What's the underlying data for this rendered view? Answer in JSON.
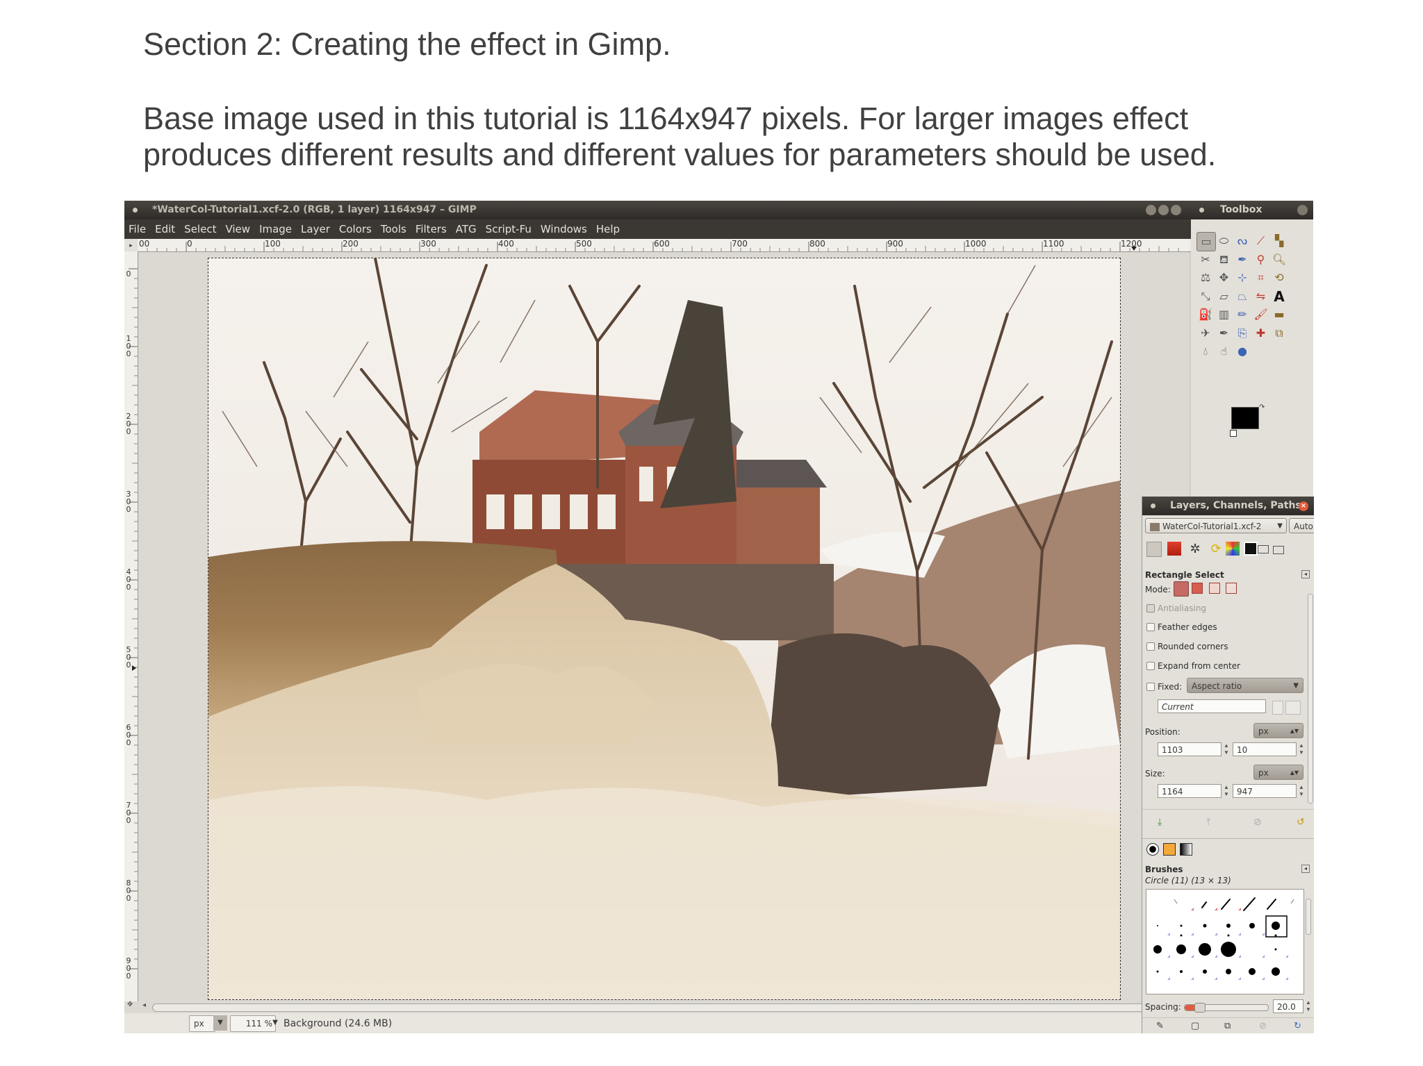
{
  "slide": {
    "title": "Section 2:  Creating the effect in Gimp.",
    "line1": "Base image used in this tutorial is 1164x947 pixels.  For larger images effect",
    "line2": "produces different results and different values for parameters should be used."
  },
  "gimp": {
    "window_title": "*WaterCol-Tutorial1.xcf-2.0 (RGB, 1 layer) 1164x947 – GIMP",
    "menu": [
      "File",
      "Edit",
      "Select",
      "View",
      "Image",
      "Layer",
      "Colors",
      "Tools",
      "Filters",
      "ATG",
      "Script-Fu",
      "Windows",
      "Help"
    ],
    "ruler_top": [
      "0",
      "100",
      "200",
      "300",
      "400",
      "500",
      "600",
      "700",
      "800",
      "900",
      "1000",
      "1100",
      "1200"
    ],
    "ruler_top_start": "00",
    "ruler_left": [
      "0",
      "100",
      "200",
      "300",
      "400",
      "500",
      "600",
      "700",
      "800",
      "900"
    ],
    "status": {
      "unit": "px",
      "zoom": "111 %",
      "info": "Background (24.6 MB)"
    }
  },
  "toolbox": {
    "title": "Toolbox",
    "fg_color": "#000000",
    "bg_color": "#ffffff",
    "tools": [
      "rect-select-icon",
      "ellipse-select-icon",
      "free-select-icon",
      "fuzzy-select-icon",
      "select-by-color-icon",
      "scissors-icon",
      "foreground-select-icon",
      "paths-icon",
      "color-picker-icon",
      "zoom-icon",
      "measure-icon",
      "move-icon",
      "align-icon",
      "crop-icon",
      "rotate-icon",
      "scale-icon",
      "shear-icon",
      "perspective-icon",
      "flip-icon",
      "text-icon",
      "bucket-fill-icon",
      "blend-icon",
      "pencil-icon",
      "paintbrush-icon",
      "eraser-icon",
      "airbrush-icon",
      "ink-icon",
      "clone-icon",
      "heal-icon",
      "perspective-clone-icon",
      "blur-icon",
      "smudge-icon",
      "dodge-burn-icon"
    ]
  },
  "dock": {
    "title": "Layers, Channels, Paths",
    "image_menu": "WaterCol-Tutorial1.xcf-2",
    "auto_btn": "Auto",
    "tool_options_title": "Rectangle Select",
    "mode_label": "Mode:",
    "antialiasing": "Antialiasing",
    "feather": "Feather edges",
    "rounded": "Rounded corners",
    "expand": "Expand from center",
    "fixed_label": "Fixed:",
    "fixed_value": "Aspect ratio",
    "current_value": "Current",
    "position_label": "Position:",
    "position_unit": "px",
    "pos_x": "1103",
    "pos_y": "10",
    "size_label": "Size:",
    "size_unit": "px",
    "size_w": "1164",
    "size_h": "947",
    "brushes_title": "Brushes",
    "brush_name": "Circle (11) (13 × 13)",
    "spacing_label": "Spacing:",
    "spacing_value": "20.0"
  }
}
